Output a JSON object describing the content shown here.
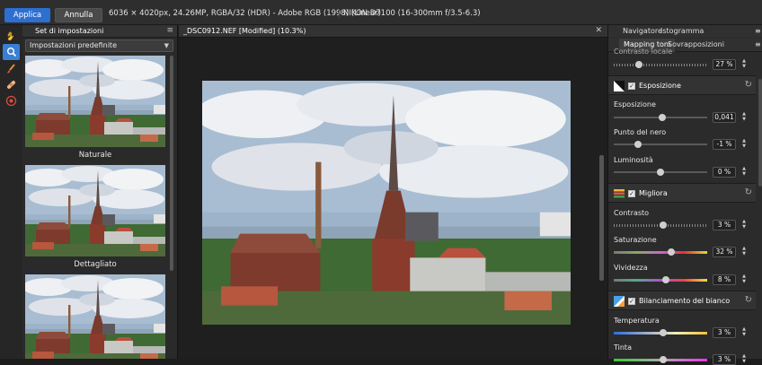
{
  "top": {
    "apply": "Applica",
    "cancel": "Annulla",
    "info": "6036 × 4020px, 24.26MP, RGBA/32 (HDR) - Adobe RGB (1998) (Linear)",
    "camera": "NIKON D7100 (16-300mm f/3.5-6.3)"
  },
  "left": {
    "tab": "Set di impostazioni",
    "select": "Impostazioni predefinite",
    "presets": [
      "Naturale",
      "Dettagliato"
    ]
  },
  "doc": {
    "title": "_DSC0912.NEF [Modified] (10.3%)"
  },
  "right": {
    "tabs_top": [
      "Navigatore",
      "Istogramma"
    ],
    "tabs": [
      "Mapping toni",
      "Sovrapposizioni"
    ],
    "local_contrast": {
      "label": "Contrasto locale",
      "value": "27 %",
      "level": 0.27
    },
    "exposure": {
      "title": "Esposizione",
      "items": [
        {
          "label": "Esposizione",
          "value": "0,041",
          "level": 0.52
        },
        {
          "label": "Punto del nero",
          "value": "-1 %",
          "level": 0.26
        },
        {
          "label": "Luminosità",
          "value": "0 %",
          "level": 0.5
        }
      ]
    },
    "enhance": {
      "title": "Migliora",
      "items": [
        {
          "label": "Contrasto",
          "value": "3 %",
          "level": 0.53
        },
        {
          "label": "Saturazione",
          "value": "32 %",
          "level": 0.62
        },
        {
          "label": "Vividezza",
          "value": "8 %",
          "level": 0.56
        }
      ]
    },
    "wb": {
      "title": "Bilanciamento del bianco",
      "items": [
        {
          "label": "Temperatura",
          "value": "3 %",
          "level": 0.53
        },
        {
          "label": "Tinta",
          "value": "3 %",
          "level": 0.53
        }
      ]
    }
  },
  "colors": {
    "accent": "#2d6fd1",
    "exposure_icon": "#ffffff",
    "enhance_icon": "#e0563c",
    "wb_icon": "#4aa0e8"
  },
  "icons": [
    "hand-icon",
    "zoom-icon",
    "brush-icon",
    "bandage-icon",
    "redeye-icon",
    "menu-icon",
    "close-icon",
    "reset-icon"
  ]
}
